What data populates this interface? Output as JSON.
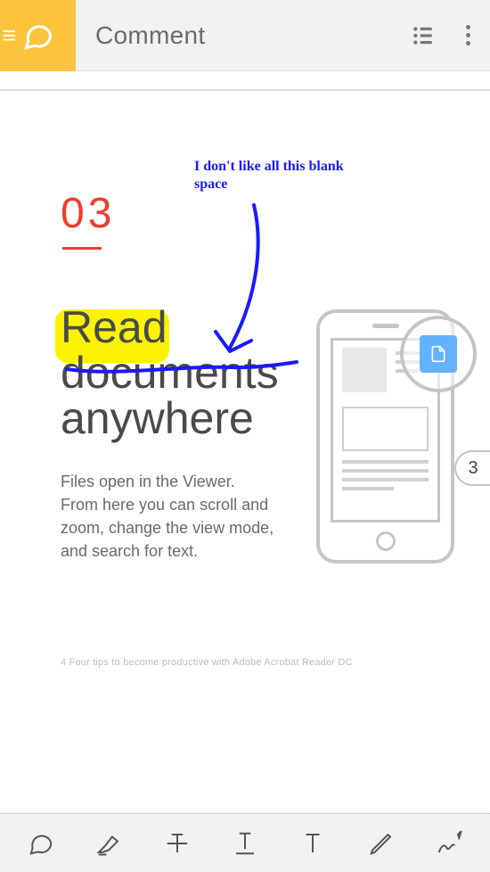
{
  "header": {
    "title": "Comment",
    "mode": "comment"
  },
  "document": {
    "section_number": "03",
    "heading_line1": "Read",
    "heading_line2": "documents",
    "heading_line3": "anywhere",
    "body_text": "Files open in the Viewer. From here you can scroll and zoom, change the view mode, and search for text.",
    "footer_text": "4  Four tips to become productive with Adobe Acrobat Reader DC"
  },
  "annotations": {
    "note_text": "I don't like all this blank space",
    "highlight_word": "Read"
  },
  "comment_count": "3",
  "tools": {
    "t1": "note",
    "t2": "highlight",
    "t3": "strikethrough",
    "t4": "underline",
    "t5": "addtext",
    "t6": "pencil",
    "t7": "signature"
  }
}
